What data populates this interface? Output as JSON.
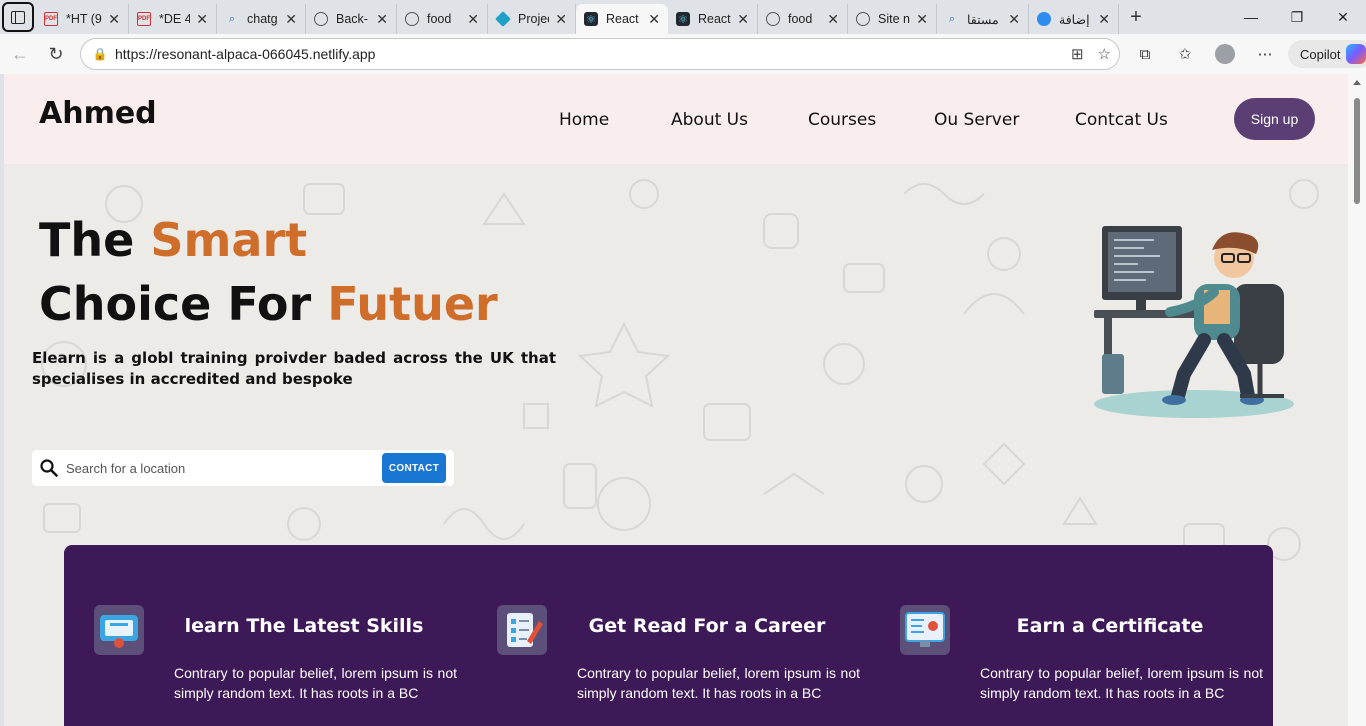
{
  "browser": {
    "tabs": [
      {
        "title": "*HT (9",
        "icon": "pdf-icon"
      },
      {
        "title": "*DE 4.",
        "icon": "pdf-icon"
      },
      {
        "title": "chatg",
        "icon": "search-icon"
      },
      {
        "title": "Back-",
        "icon": "openai-icon"
      },
      {
        "title": "food",
        "icon": "globe-icon"
      },
      {
        "title": "Projec",
        "icon": "project-icon"
      },
      {
        "title": "React",
        "icon": "react-icon",
        "active": true
      },
      {
        "title": "React",
        "icon": "react-icon"
      },
      {
        "title": "food",
        "icon": "globe-icon"
      },
      {
        "title": "Site n",
        "icon": "globe-icon"
      },
      {
        "title": "مستقا",
        "icon": "search-icon"
      },
      {
        "title": "إضافة",
        "icon": "edge-addon-icon"
      }
    ],
    "url": "https://resonant-alpaca-066045.netlify.app",
    "copilot_label": "Copilot"
  },
  "site": {
    "brand": "Ahmed",
    "nav": [
      "Home",
      "About Us",
      "Courses",
      "Ou Server",
      "Contcat Us"
    ],
    "signup": "Sign up",
    "hero": {
      "line1_plain": "The ",
      "line1_accent": "Smart",
      "line2_plain": "Choice For ",
      "line2_accent": "Futuer",
      "description": "Elearn is a globl training proivder baded across the UK that specialises in accredited and bespoke",
      "search_placeholder": "Search for a location",
      "contact_label": "CONTACT"
    },
    "features": [
      {
        "icon": "certificate-display-icon",
        "title": "learn The Latest Skills",
        "text": "Contrary to popular belief, lorem ipsum is not simply random text. It has roots in a BC"
      },
      {
        "icon": "checklist-pen-icon",
        "title": "Get Read For a Career",
        "text": "Contrary to popular belief, lorem ipsum is not simply random text. It has roots in a BC"
      },
      {
        "icon": "online-certificate-icon",
        "title": "Earn a Certificate",
        "text": "Contrary to popular belief, lorem ipsum is not simply random text. It has roots in a BC"
      }
    ]
  },
  "colors": {
    "accent_orange": "#cf6d2b",
    "purple_panel": "#3e1957",
    "signup_purple": "#5b3e74",
    "nav_bg": "#f9eded",
    "contact_blue": "#1976d2"
  }
}
